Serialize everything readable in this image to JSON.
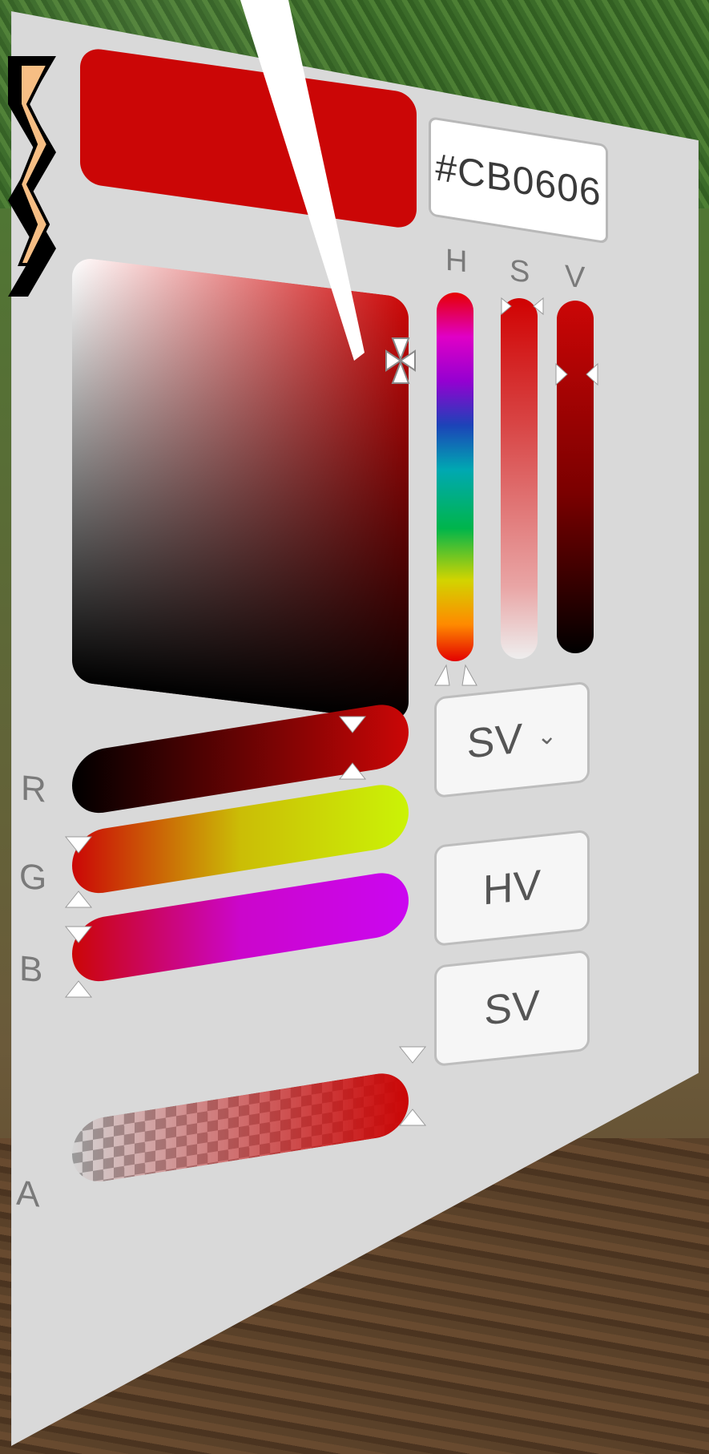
{
  "colors": {
    "current": "#CB0606",
    "panel_bg": "#d9d9d9",
    "accent": "#CB0606"
  },
  "hex_field": {
    "value": "#CB0606"
  },
  "hsv_labels": {
    "h": "H",
    "s": "S",
    "v": "V"
  },
  "rgb_labels": {
    "r": "R",
    "g": "G",
    "b": "B",
    "a": "A"
  },
  "mode_dropdown": {
    "value": "SV"
  },
  "buttons": {
    "hv": "HV",
    "sv": "SV"
  },
  "icons": {
    "dropdown": "chevron-down-icon",
    "zigzag": "zigzag-icon"
  }
}
